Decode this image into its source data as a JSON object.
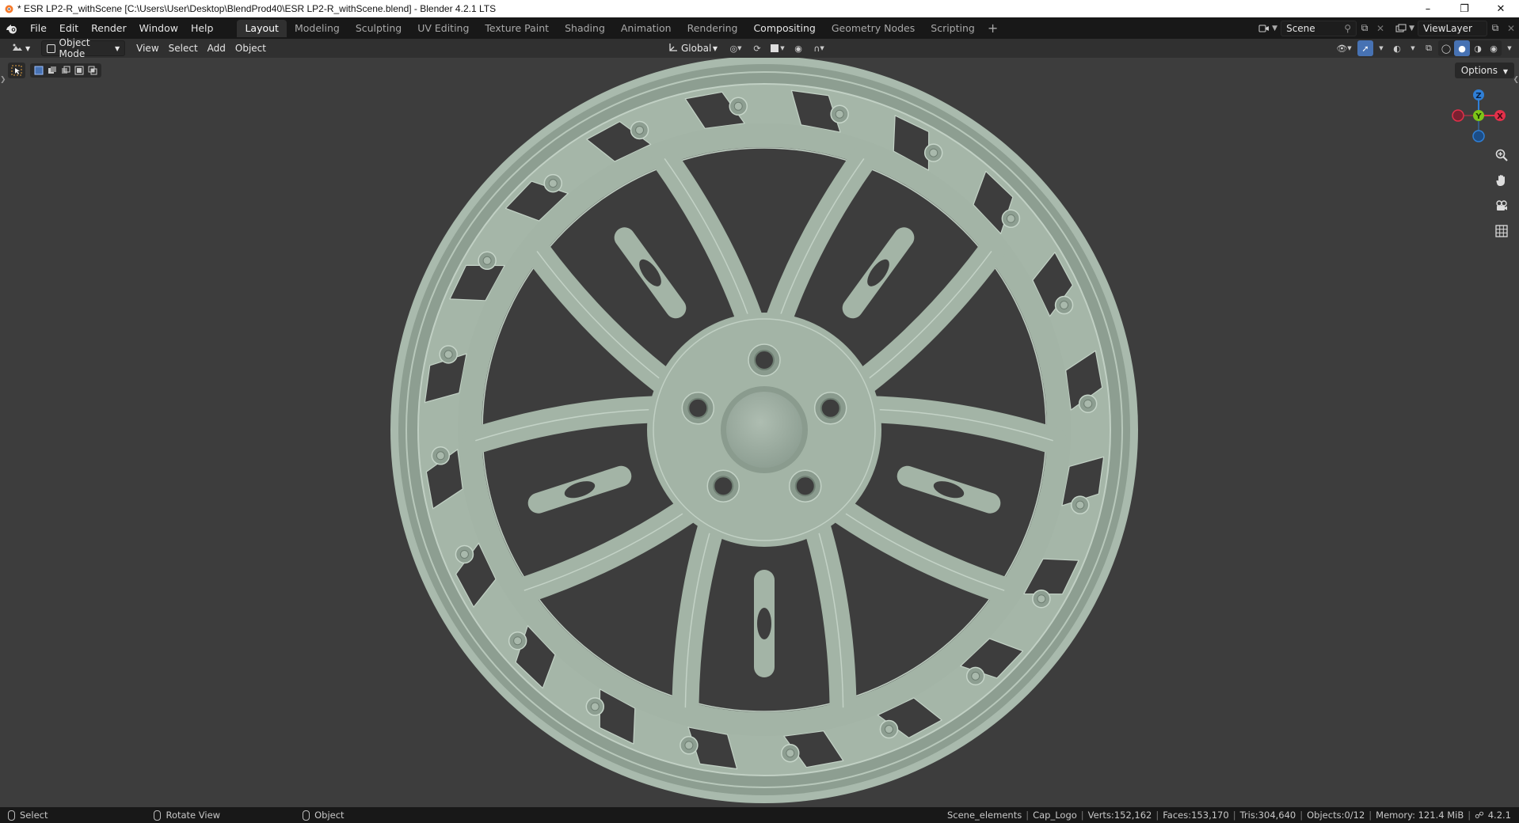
{
  "window": {
    "title": "* ESR LP2-R_withScene [C:\\Users\\User\\Desktop\\BlendProd40\\ESR LP2-R_withScene.blend] - Blender 4.2.1 LTS",
    "controls": [
      "minimize-icon",
      "restore-icon",
      "close-icon"
    ]
  },
  "menu": {
    "items": [
      "File",
      "Edit",
      "Render",
      "Window",
      "Help"
    ]
  },
  "workspaces": {
    "tabs": [
      "Layout",
      "Modeling",
      "Sculpting",
      "UV Editing",
      "Texture Paint",
      "Shading",
      "Animation",
      "Rendering",
      "Compositing",
      "Geometry Nodes",
      "Scripting"
    ],
    "active": "Layout",
    "add_icon": "plus-icon"
  },
  "scene": {
    "scene_name": "Scene",
    "view_layer": "ViewLayer"
  },
  "viewport_header": {
    "mode": "Object Mode",
    "menus": [
      "View",
      "Select",
      "Add",
      "Object"
    ],
    "orientation": "Global"
  },
  "viewport": {
    "options_label": "Options",
    "gizmo_axes": [
      "Z",
      "Y",
      "X"
    ]
  },
  "statusbar": {
    "hints": [
      {
        "label": "Select"
      },
      {
        "label": "Rotate View"
      },
      {
        "label": "Object"
      }
    ],
    "collection": "Scene_elements",
    "object": "Cap_Logo",
    "verts": "Verts:152,162",
    "faces": "Faces:153,170",
    "tris": "Tris:304,640",
    "objects": "Objects:0/12",
    "memory": "Memory: 121.4 MiB",
    "version": "4.2.1"
  },
  "colors": {
    "wheel": "#9fb0a3",
    "background": "#3d3d3d",
    "accent": "#4772b3",
    "axis_x": "#e2304a",
    "axis_y": "#7ec518",
    "axis_z": "#2f7fd6"
  }
}
